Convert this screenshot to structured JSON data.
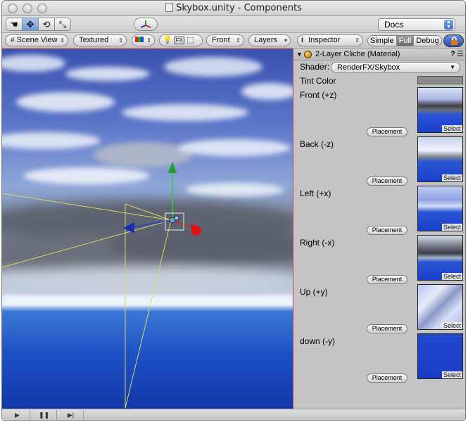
{
  "window": {
    "title": "Skybox.unity - Components"
  },
  "toolbar": {
    "docs_value": "Docs",
    "tools": [
      "hand-tool",
      "move-tool",
      "rotate-tool",
      "scale-tool"
    ],
    "tool_glyphs": [
      "☚",
      "✥",
      "⟲",
      "⤡"
    ]
  },
  "scene_toolbar": {
    "scene_view": "Scene View",
    "render_mode": "Textured",
    "camera_view": "Front",
    "layers": "Layers"
  },
  "inspector": {
    "tab_label": "Inspector",
    "mode_simple": "Simple",
    "mode_full": "Full",
    "mode_debug": "Debug",
    "component_title": "2-Layer Cliche (Material)",
    "help_glyph": "?",
    "shader_label": "Shader:",
    "shader_value": "RenderFX/Skybox",
    "tint_label": "Tint Color",
    "tint_color": "#8c8c8c",
    "placement_label": "Placement",
    "select_label": "Select",
    "textures": [
      {
        "label": "Front (+z)"
      },
      {
        "label": "Back (-z)"
      },
      {
        "label": "Left (+x)"
      },
      {
        "label": "Right (-x)"
      },
      {
        "label": "Up (+y)"
      },
      {
        "label": "down (-y)"
      }
    ]
  },
  "colors": {
    "accent_blue": "#3b6fc2",
    "scene_border": "#b04050",
    "sky_blue": "#1d4fc6"
  }
}
